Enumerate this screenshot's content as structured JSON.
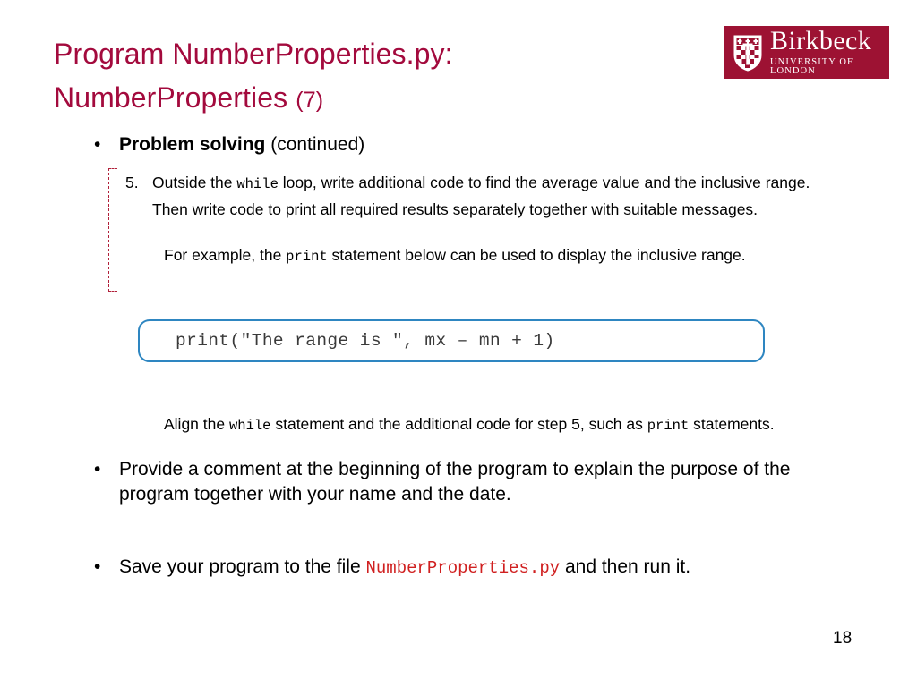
{
  "slide": {
    "title_line1": "Program NumberProperties.py:",
    "title_line2_main": "NumberProperties",
    "title_line2_paren": "(7)",
    "title_color": "#a30a3d",
    "page_number": "18"
  },
  "logo": {
    "name": "Birkbeck",
    "subtitle": "UNIVERSITY OF LONDON",
    "background_color": "#9d1233",
    "crest_icon": "shield-crest-icon"
  },
  "content": {
    "bullet1": {
      "marker": "•",
      "bold_text": "Problem solving",
      "rest_text": " (continued)"
    },
    "step5": {
      "number": "5.",
      "part1": "Outside the ",
      "code1": "while",
      "part2": "  loop, write additional code to find the average value and the inclusive range. Then write code to print all required results separately together with suitable messages."
    },
    "example_para": {
      "part1": "For example, the ",
      "code1": "print",
      "part2": " statement below can be used to display the inclusive range."
    },
    "codebox": {
      "code": "print(\"The range is \", mx – mn + 1)",
      "border_color": "#2e86c1"
    },
    "align_para": {
      "part1": "Align the ",
      "code1": "while",
      "part2": " statement and the additional code for step 5, such as ",
      "code2": "print",
      "part3": " statements."
    },
    "bullet2": {
      "marker": "•",
      "text": "Provide a comment at the beginning of the program to explain the purpose of the program together with your name and the date."
    },
    "bullet3": {
      "marker": "•",
      "part1": "Save your program to the file ",
      "filename": "NumberProperties.py",
      "part2": "  and then run it.",
      "filename_color": "#d02020"
    }
  }
}
